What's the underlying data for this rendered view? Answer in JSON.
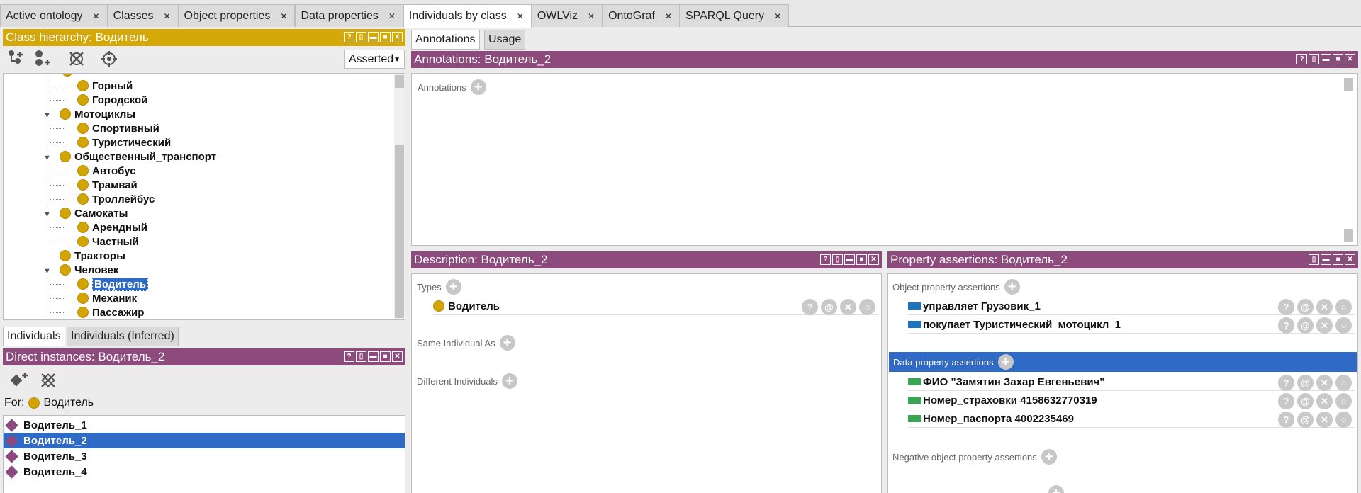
{
  "tabs": [
    {
      "label": "Active ontology"
    },
    {
      "label": "Classes"
    },
    {
      "label": "Object properties"
    },
    {
      "label": "Data properties"
    },
    {
      "label": "Individuals by class"
    },
    {
      "label": "OWLViz"
    },
    {
      "label": "OntoGraf"
    },
    {
      "label": "SPARQL Query"
    }
  ],
  "class_hierarchy": {
    "title": "Class hierarchy: Водитель",
    "mode": "Asserted",
    "items": {
      "gorny": "Горный",
      "gorodskoy": "Городской",
      "motocikly": "Мотоциклы",
      "sportivny": "Спортивный",
      "turistichesky": "Туристический",
      "obsh_transport": "Общественный_транспорт",
      "avtobus": "Автобус",
      "tramvay": "Трамвай",
      "trolleybus": "Троллейбус",
      "samokaty": "Самокаты",
      "arendny": "Арендный",
      "chastny": "Частный",
      "traktory": "Тракторы",
      "chelovek": "Человек",
      "voditel": "Водитель",
      "mekhanik": "Механик",
      "passazhir": "Пассажир"
    }
  },
  "individuals_tabs": {
    "asserted": "Individuals",
    "inferred": "Individuals (Inferred)"
  },
  "direct_instances": {
    "title": "Direct instances: Водитель_2",
    "for_label": "For:",
    "for_class": "Водитель",
    "items": [
      "Водитель_1",
      "Водитель_2",
      "Водитель_3",
      "Водитель_4"
    ],
    "selected_index": 1
  },
  "right_tabs": {
    "annotations": "Annotations",
    "usage": "Usage"
  },
  "annotations": {
    "title": "Annotations: Водитель_2",
    "label": "Annotations"
  },
  "description": {
    "title": "Description: Водитель_2",
    "types_label": "Types",
    "type_value": "Водитель",
    "same_label": "Same Individual As",
    "different_label": "Different Individuals"
  },
  "property_assertions": {
    "title": "Property assertions: Водитель_2",
    "object_label": "Object property assertions",
    "object_items": [
      {
        "prop": "управляет",
        "value": "Грузовик_1"
      },
      {
        "prop": "покупает",
        "value": "Туристический_мотоцикл_1"
      }
    ],
    "data_label": "Data property assertions",
    "data_items": [
      {
        "prop": "ФИО",
        "value": "\"Замятин Захар Евгеньевич\""
      },
      {
        "prop": "Номер_страховки",
        "value": "4158632770319"
      },
      {
        "prop": "Номер_паспорта",
        "value": "4002235469"
      }
    ],
    "neg_object_label": "Negative object property assertions"
  },
  "colors": {
    "class_gold": "#d3a807",
    "panel_purple": "#8d4a7c",
    "selection_blue": "#2f6bc6",
    "object_prop_blue": "#1c73c0",
    "data_prop_green": "#3aa655"
  }
}
